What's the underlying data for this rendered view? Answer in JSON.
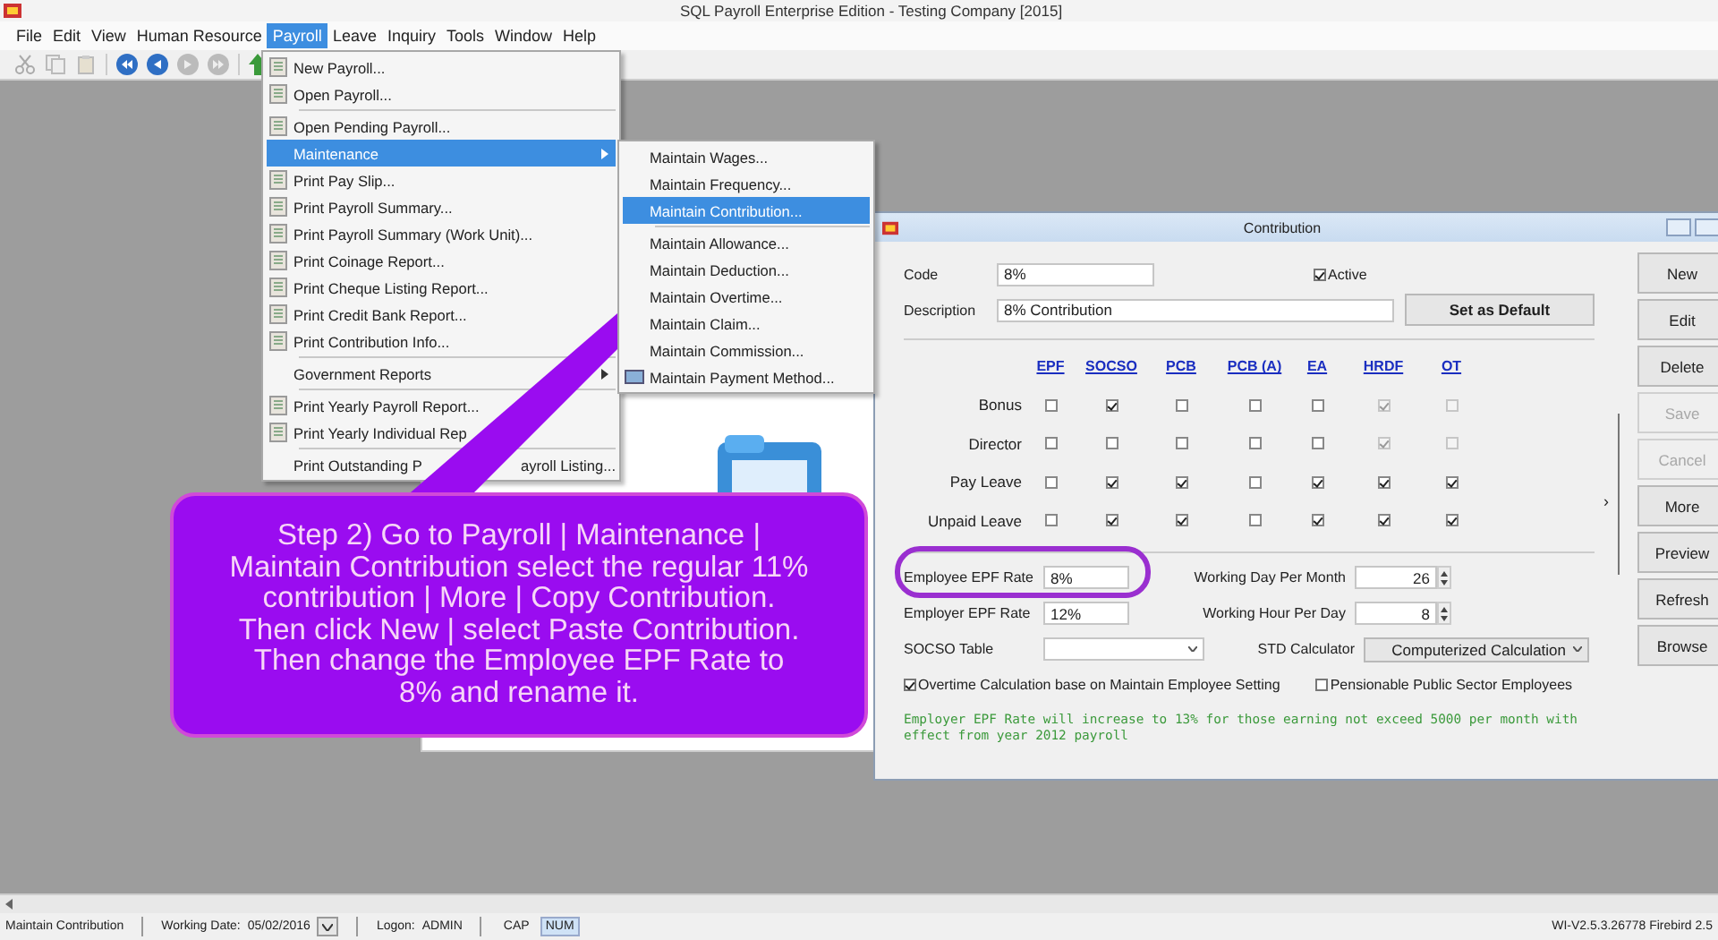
{
  "app": {
    "title": "SQL Payroll Enterprise Edition - Testing Company [2015]"
  },
  "menubar": [
    {
      "label": "File",
      "selected": false
    },
    {
      "label": "Edit",
      "selected": false
    },
    {
      "label": "View",
      "selected": false
    },
    {
      "label": "Human Resource",
      "selected": false
    },
    {
      "label": "Payroll",
      "selected": true
    },
    {
      "label": "Leave",
      "selected": false
    },
    {
      "label": "Inquiry",
      "selected": false
    },
    {
      "label": "Tools",
      "selected": false
    },
    {
      "label": "Window",
      "selected": false
    },
    {
      "label": "Help",
      "selected": false
    }
  ],
  "payroll_menu": [
    {
      "kind": "item",
      "label": "New Payroll...",
      "icon": true,
      "submenu": false,
      "selected": false
    },
    {
      "kind": "item",
      "label": "Open Payroll...",
      "icon": true,
      "submenu": false,
      "selected": false
    },
    {
      "kind": "separator"
    },
    {
      "kind": "item",
      "label": "Open Pending Payroll...",
      "icon": true,
      "submenu": false,
      "selected": false
    },
    {
      "kind": "item",
      "label": "Maintenance",
      "icon": false,
      "submenu": true,
      "selected": true
    },
    {
      "kind": "item",
      "label": "Print Pay Slip...",
      "icon": true,
      "submenu": false,
      "selected": false
    },
    {
      "kind": "item",
      "label": "Print Payroll Summary...",
      "icon": true,
      "submenu": false,
      "selected": false
    },
    {
      "kind": "item",
      "label": "Print Payroll Summary (Work Unit)...",
      "icon": true,
      "submenu": false,
      "selected": false
    },
    {
      "kind": "item",
      "label": "Print Coinage Report...",
      "icon": true,
      "submenu": false,
      "selected": false
    },
    {
      "kind": "item",
      "label": "Print Cheque Listing Report...",
      "icon": true,
      "submenu": false,
      "selected": false
    },
    {
      "kind": "item",
      "label": "Print Credit Bank Report...",
      "icon": true,
      "submenu": false,
      "selected": false
    },
    {
      "kind": "item",
      "label": "Print Contribution Info...",
      "icon": true,
      "submenu": false,
      "selected": false
    },
    {
      "kind": "separator"
    },
    {
      "kind": "item",
      "label": "Government Reports",
      "icon": false,
      "submenu": true,
      "selected": false
    },
    {
      "kind": "separator"
    },
    {
      "kind": "item",
      "label": "Print Yearly Payroll Report...",
      "icon": true,
      "submenu": false,
      "selected": false
    },
    {
      "kind": "item",
      "label": "Print Yearly Individual Rep",
      "icon": true,
      "submenu": false,
      "selected": false
    },
    {
      "kind": "separator"
    },
    {
      "kind": "split",
      "label": "Print Outstanding P",
      "tail": "ayroll Listing...",
      "selected": false
    }
  ],
  "maintenance_menu": [
    {
      "kind": "item",
      "label": "Maintain Wages...",
      "icon": false,
      "selected": false
    },
    {
      "kind": "item",
      "label": "Maintain Frequency...",
      "icon": false,
      "selected": false
    },
    {
      "kind": "item",
      "label": "Maintain Contribution...",
      "icon": false,
      "selected": true
    },
    {
      "kind": "separator"
    },
    {
      "kind": "item",
      "label": "Maintain Allowance...",
      "icon": false,
      "selected": false
    },
    {
      "kind": "item",
      "label": "Maintain Deduction...",
      "icon": false,
      "selected": false
    },
    {
      "kind": "item",
      "label": "Maintain Overtime...",
      "icon": false,
      "selected": false
    },
    {
      "kind": "item",
      "label": "Maintain Claim...",
      "icon": false,
      "selected": false
    },
    {
      "kind": "item",
      "label": "Maintain Commission...",
      "icon": false,
      "selected": false
    },
    {
      "kind": "item",
      "label": "Maintain Payment Method...",
      "icon": true,
      "selected": false
    }
  ],
  "callout": {
    "text": "Step 2) Go to Payroll | Maintenance |\nMaintain Contribution select the regular 11%\ncontribution | More | Copy Contribution.\nThen click New | select Paste Contribution.\nThen change the Employee EPF Rate to\n8% and rename it."
  },
  "dialog": {
    "title": "Contribution",
    "code": {
      "label": "Code",
      "value": "8%"
    },
    "active": {
      "label": "Active",
      "checked": true
    },
    "description": {
      "label": "Description",
      "value": "8% Contribution"
    },
    "default_button": "Set as Default",
    "columns": [
      "EPF",
      "SOCSO",
      "PCB",
      "PCB (A)",
      "EA",
      "HRDF",
      "OT"
    ],
    "rows": [
      {
        "label": "Bonus",
        "cells": [
          {
            "checked": false,
            "disabled": false
          },
          {
            "checked": true,
            "disabled": false
          },
          {
            "checked": false,
            "disabled": false
          },
          {
            "checked": false,
            "disabled": false
          },
          {
            "checked": false,
            "disabled": false
          },
          {
            "checked": true,
            "disabled": true
          },
          {
            "checked": false,
            "disabled": true
          }
        ]
      },
      {
        "label": "Director",
        "cells": [
          {
            "checked": false,
            "disabled": false
          },
          {
            "checked": false,
            "disabled": false
          },
          {
            "checked": false,
            "disabled": false
          },
          {
            "checked": false,
            "disabled": false
          },
          {
            "checked": false,
            "disabled": false
          },
          {
            "checked": true,
            "disabled": true
          },
          {
            "checked": false,
            "disabled": true
          }
        ]
      },
      {
        "label": "Pay Leave",
        "cells": [
          {
            "checked": false,
            "disabled": false
          },
          {
            "checked": true,
            "disabled": false
          },
          {
            "checked": true,
            "disabled": false
          },
          {
            "checked": false,
            "disabled": false
          },
          {
            "checked": true,
            "disabled": false
          },
          {
            "checked": true,
            "disabled": false
          },
          {
            "checked": true,
            "disabled": false
          }
        ]
      },
      {
        "label": "Unpaid Leave",
        "cells": [
          {
            "checked": false,
            "disabled": false
          },
          {
            "checked": true,
            "disabled": false
          },
          {
            "checked": true,
            "disabled": false
          },
          {
            "checked": false,
            "disabled": false
          },
          {
            "checked": true,
            "disabled": false
          },
          {
            "checked": true,
            "disabled": false
          },
          {
            "checked": true,
            "disabled": false
          }
        ]
      }
    ],
    "employee_epf": {
      "label": "Employee EPF Rate",
      "value": "8%"
    },
    "employer_epf": {
      "label": "Employer EPF Rate",
      "value": "12%"
    },
    "working_day": {
      "label": "Working Day Per Month",
      "value": "26"
    },
    "working_hour": {
      "label": "Working Hour Per Day",
      "value": "8"
    },
    "socso_table": {
      "label": "SOCSO Table"
    },
    "std_calculator": {
      "label": "STD Calculator",
      "value": "Computerized Calculation"
    },
    "overtime": {
      "label": "Overtime Calculation base on Maintain Employee Setting",
      "checked": true
    },
    "pensionable": {
      "label": "Pensionable Public Sector Employees",
      "checked": false
    },
    "note": "Employer EPF Rate will increase to 13% for those earning not exceed 5000 per month with effect from year 2012 payroll",
    "splitter": "›",
    "buttons": [
      {
        "label": "New",
        "disabled": false
      },
      {
        "label": "Edit",
        "disabled": false
      },
      {
        "label": "Delete",
        "disabled": false
      },
      {
        "label": "Save",
        "disabled": true
      },
      {
        "label": "Cancel",
        "disabled": true
      },
      {
        "label": "More",
        "disabled": false
      },
      {
        "label": "Preview",
        "disabled": false
      },
      {
        "label": "Refresh",
        "disabled": false
      },
      {
        "label": "Browse",
        "disabled": false
      }
    ]
  },
  "status_bar": {
    "module": "Maintain Contribution",
    "working_date_label": "Working Date:",
    "working_date": "05/02/2016",
    "logon_label": "Logon:",
    "user": "ADMIN",
    "keys": [
      {
        "label": "CAP",
        "on": false
      },
      {
        "label": "NUM",
        "on": true
      }
    ],
    "version": "WI-V2.5.3.26778 Firebird 2.5"
  }
}
